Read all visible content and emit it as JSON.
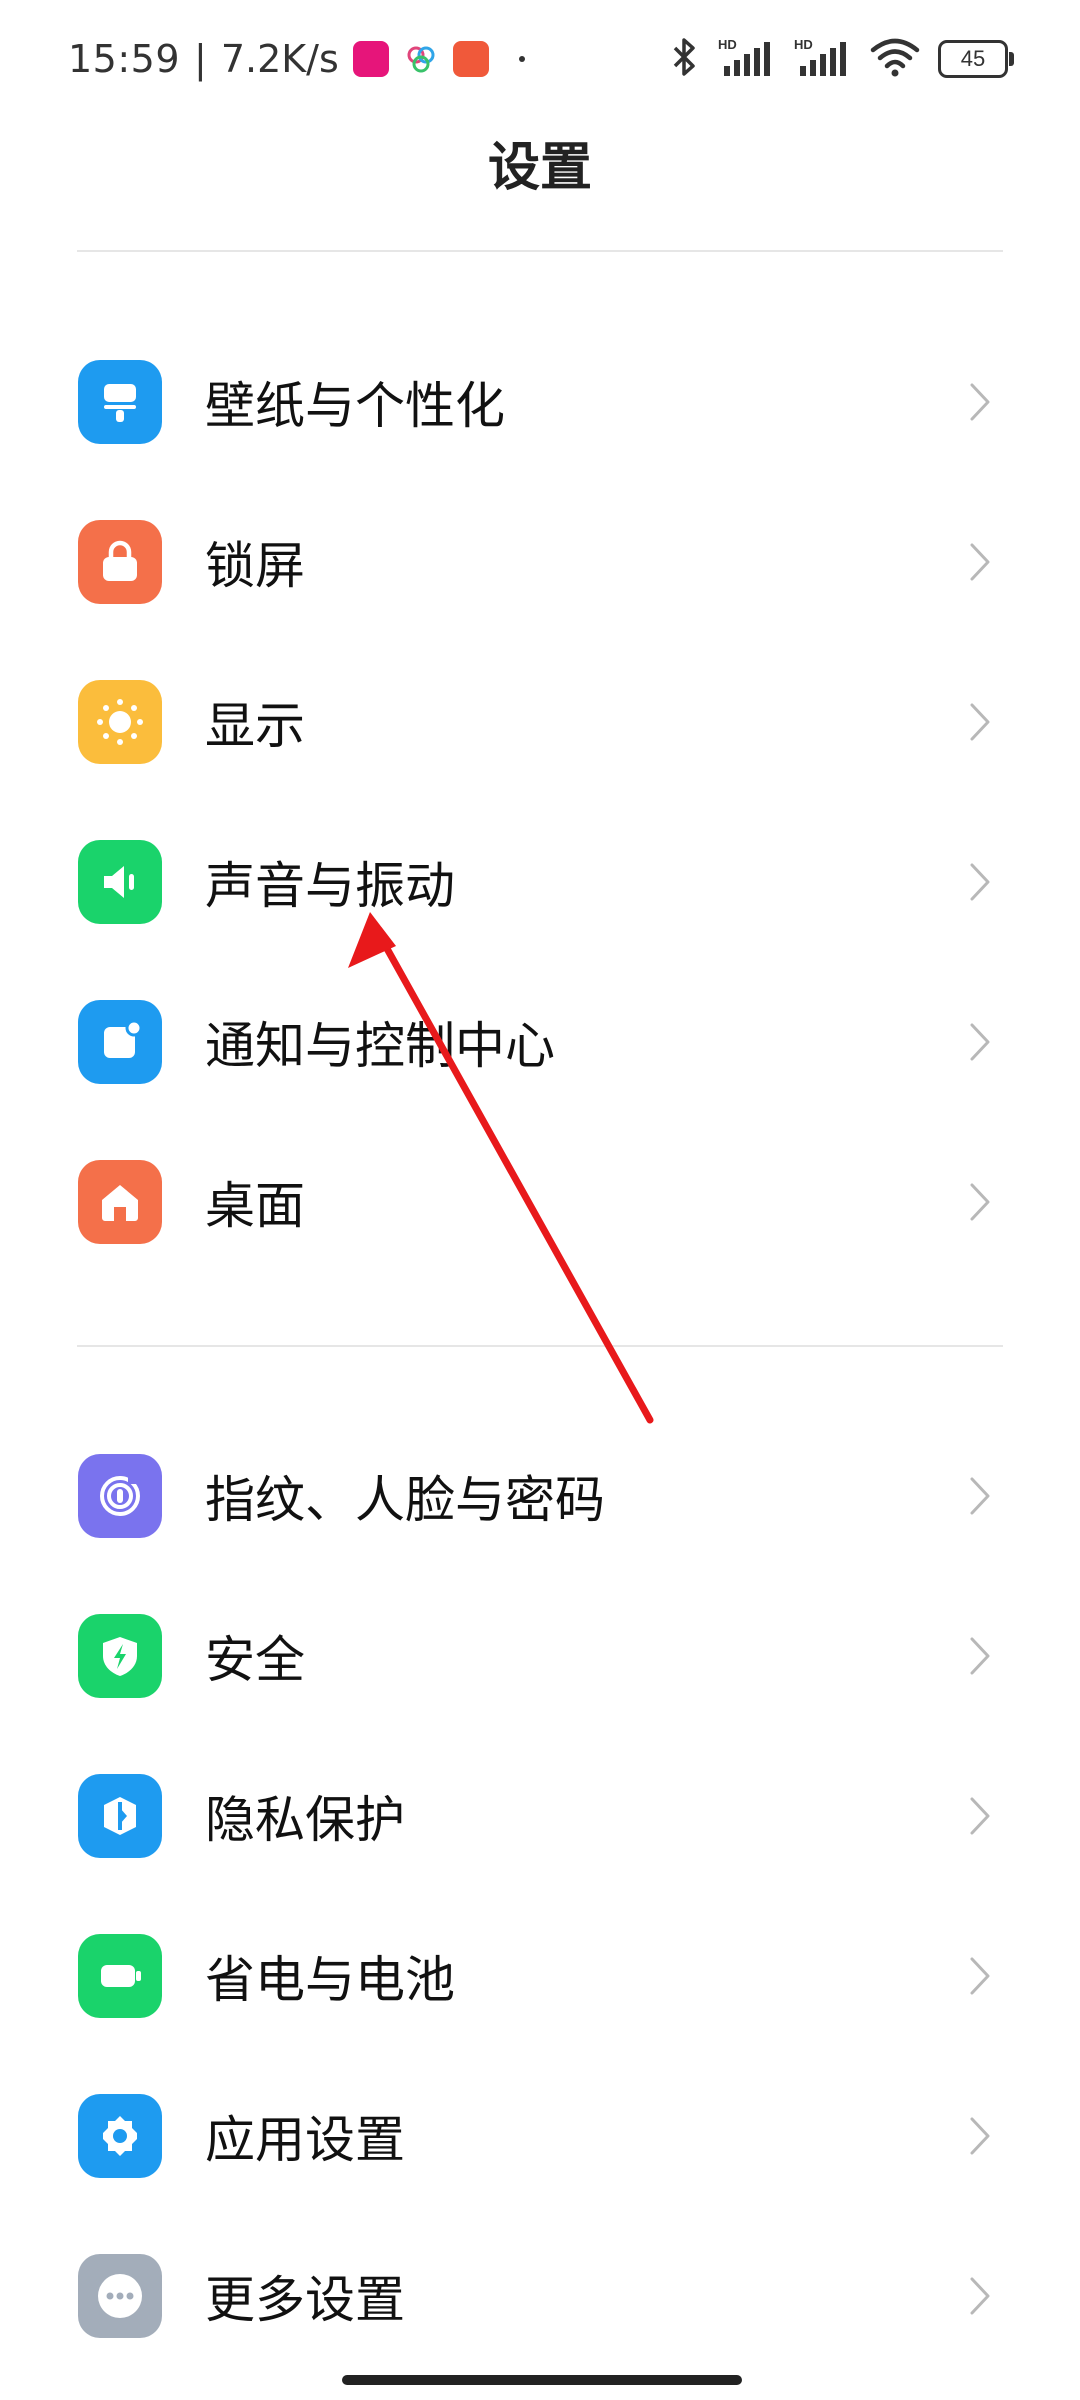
{
  "status_bar": {
    "time": "15:59",
    "separator": "|",
    "net_speed": "7.2K/s",
    "battery_level": "45",
    "icons": [
      "bluetooth-icon",
      "hd-signal-icon",
      "hd-signal-icon",
      "wifi-icon",
      "battery-icon"
    ]
  },
  "header": {
    "title": "设置"
  },
  "groups": [
    {
      "items": [
        {
          "label": "壁纸与个性化",
          "icon": "wallpaper-icon",
          "color": "#1e9bf0"
        },
        {
          "label": "锁屏",
          "icon": "lock-icon",
          "color": "#f4704a"
        },
        {
          "label": "显示",
          "icon": "sun-icon",
          "color": "#fbbd3c"
        },
        {
          "label": "声音与振动",
          "icon": "speaker-icon",
          "color": "#1ad36b"
        },
        {
          "label": "通知与控制中心",
          "icon": "notification-icon",
          "color": "#1e9bf0"
        },
        {
          "label": "桌面",
          "icon": "home-icon",
          "color": "#f4704a"
        }
      ]
    },
    {
      "items": [
        {
          "label": "指纹、人脸与密码",
          "icon": "fingerprint-icon",
          "color": "#7a73ee"
        },
        {
          "label": "安全",
          "icon": "shield-icon",
          "color": "#1ad36b"
        },
        {
          "label": "隐私保护",
          "icon": "privacy-icon",
          "color": "#1e9bf0"
        },
        {
          "label": "省电与电池",
          "icon": "battery-saver-icon",
          "color": "#1ad36b"
        },
        {
          "label": "应用设置",
          "icon": "gear-icon",
          "color": "#1e9bf0"
        },
        {
          "label": "更多设置",
          "icon": "more-icon",
          "color": "#a3adba"
        }
      ]
    }
  ],
  "annotation": {
    "color": "#e8191b"
  }
}
